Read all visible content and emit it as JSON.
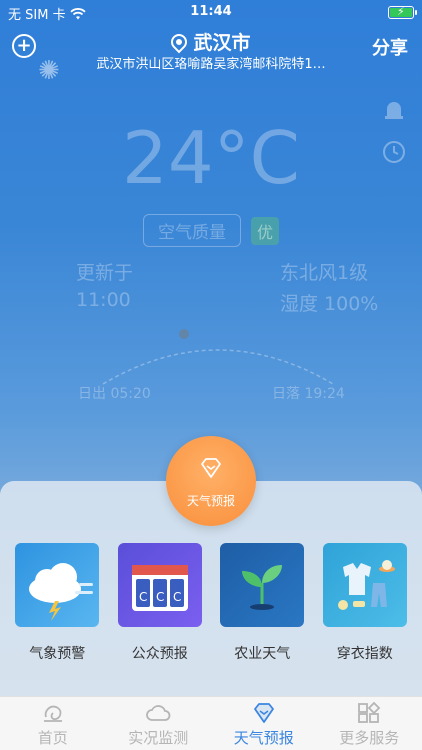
{
  "status_bar": {
    "carrier": "无 SIM 卡",
    "time": "11:44"
  },
  "header": {
    "city": "武汉市",
    "address": "武汉市洪山区珞喻路吴家湾邮科院特1…",
    "share_label": "分享"
  },
  "weather": {
    "temperature": "24°C",
    "aqi_label": "空气质量",
    "aqi_value": "优",
    "updated_label": "更新于",
    "updated_time": "11:00",
    "wind": "东北风1级",
    "humidity": "湿度 100%",
    "sunrise": "日出 05:20",
    "sunset": "日落 19:24"
  },
  "popup": {
    "center_label": "天气预报",
    "items": [
      {
        "label": "气象预警",
        "icon": "storm-cloud-icon"
      },
      {
        "label": "公众预报",
        "icon": "calendar-forecast-icon"
      },
      {
        "label": "农业天气",
        "icon": "sprout-icon"
      },
      {
        "label": "穿衣指数",
        "icon": "clothing-icon"
      }
    ]
  },
  "tabbar": {
    "tabs": [
      {
        "label": "首页",
        "icon": "home-icon"
      },
      {
        "label": "实况监测",
        "icon": "cloud-icon"
      },
      {
        "label": "天气预报",
        "icon": "gem-icon"
      },
      {
        "label": "更多服务",
        "icon": "grid-icon"
      }
    ],
    "active_color": "#3b86e0",
    "inactive_color": "#b5b5b5"
  }
}
